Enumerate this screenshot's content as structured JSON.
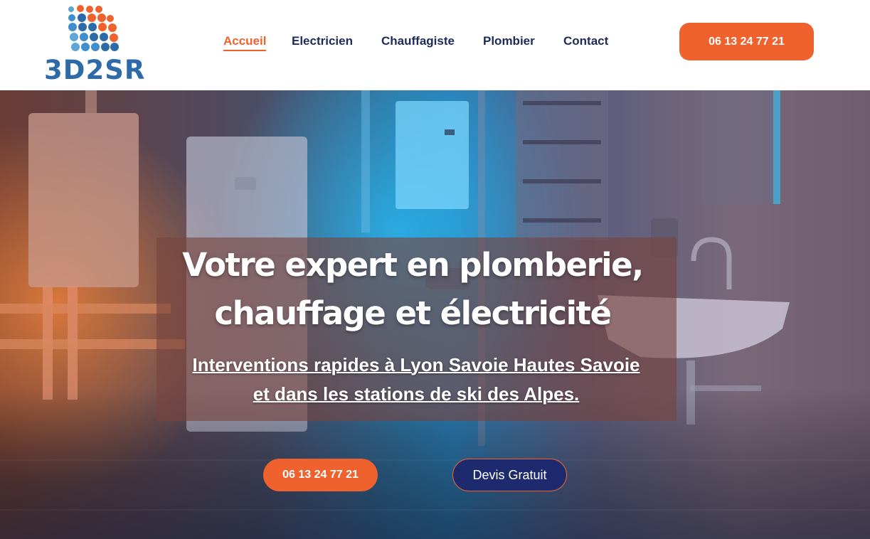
{
  "brand": {
    "name": "3D2SR",
    "primary": "#f0622d",
    "navy": "#1d2a5c",
    "logo_blue": "#2c6aa8"
  },
  "nav": {
    "items": [
      {
        "label": "Accueil",
        "active": true
      },
      {
        "label": "Electricien",
        "active": false
      },
      {
        "label": "Chauffagiste",
        "active": false
      },
      {
        "label": "Plombier",
        "active": false
      },
      {
        "label": "Contact",
        "active": false
      }
    ]
  },
  "header": {
    "phone_label": "06 13 24 77 21"
  },
  "hero": {
    "title_line1": "Votre expert en plomberie,",
    "title_line2": "chauffage et électricité",
    "subtitle_line1": "Interventions rapides à Lyon Savoie Hautes Savoie ",
    "subtitle_line2": "et dans les stations de ski des Alpes.",
    "phone_button_label": "06 13 24 77 21",
    "quote_button_label": "Devis Gratuit"
  }
}
